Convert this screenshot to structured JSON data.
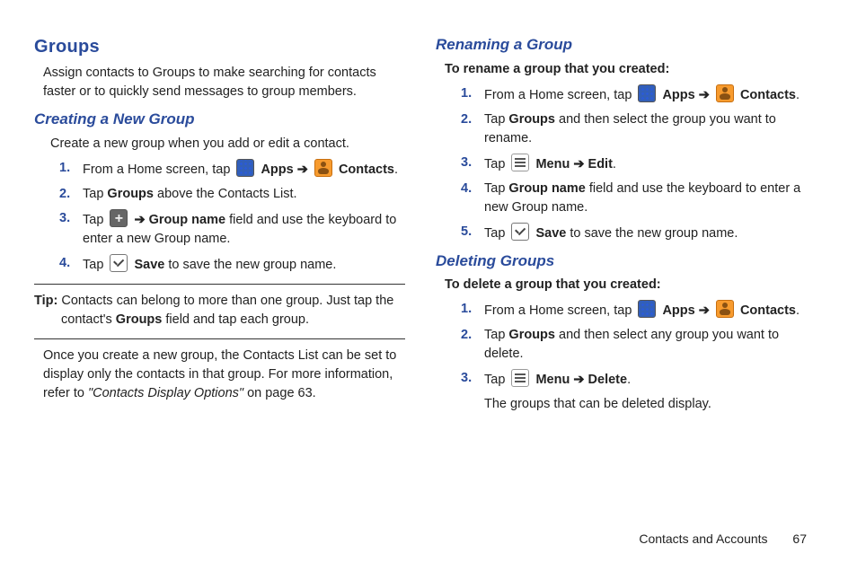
{
  "col1": {
    "h1": "Groups",
    "intro": "Assign contacts to Groups to make searching for contacts faster or to quickly send messages to group members.",
    "h2a": "Creating a New Group",
    "sub1": "Create a new group when you add or edit a contact.",
    "s1a_pre": "From a Home screen, tap ",
    "apps": "Apps",
    "arr": "➔",
    "contacts": "Contacts",
    "period": ".",
    "s2a_t1": "Tap ",
    "s2a_b": "Groups",
    "s2a_t2": " above the Contacts List.",
    "s3a_t1": "Tap ",
    "s3a_b": "Group name",
    "s3a_t2": " field and use the keyboard to enter a new Group name.",
    "s4a_t1": "Tap ",
    "s4a_b": "Save",
    "s4a_t2": " to save the new group name.",
    "tip_label": "Tip:",
    "tip_body": " Contacts can belong to more than one group. Just tap the contact's ",
    "tip_b": "Groups",
    "tip_body2": " field and tap each group.",
    "para2": "Once you create a new group, the Contacts List can be set to display only the contacts in that group. For more information, refer to ",
    "para2_ref": "\"Contacts Display Options\"",
    "para2_tail": "  on page 63."
  },
  "col2": {
    "h2b": "Renaming a Group",
    "leadb": "To rename a group that you created:",
    "s1b_pre": "From a Home screen, tap ",
    "s2b_t1": "Tap ",
    "s2b_b": "Groups",
    "s2b_t2": " and then select the group you want to rename.",
    "s3b_t1": "Tap ",
    "s3b_b1": "Menu",
    "s3b_b2": "Edit",
    "s4b_t1": "Tap ",
    "s4b_b": "Group name",
    "s4b_t2": " field and use the keyboard to enter a new Group name.",
    "s5b_t1": "Tap ",
    "s5b_b": "Save",
    "s5b_t2": " to save the new group name.",
    "h2c": "Deleting Groups",
    "leadc": "To delete a group that you created:",
    "s1c_pre": "From a Home screen, tap ",
    "s2c_t1": "Tap ",
    "s2c_b": "Groups",
    "s2c_t2": " and then select any group you want to delete.",
    "s3c_t1": "Tap ",
    "s3c_b1": "Menu",
    "s3c_b2": "Delete",
    "s3c_tail": "The groups that can be deleted display."
  },
  "footer": {
    "section": "Contacts and Accounts",
    "page": "67"
  }
}
